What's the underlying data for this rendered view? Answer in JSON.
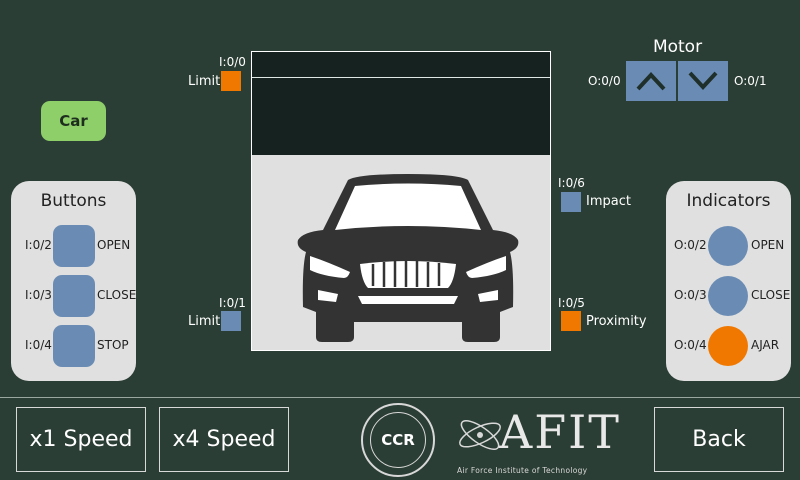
{
  "car_button": "Car",
  "garage": {
    "top_limit": {
      "addr": "I:0/0",
      "label": "Limit",
      "color": "#f07800"
    },
    "bottom_limit": {
      "addr": "I:0/1",
      "label": "Limit",
      "color": "#6a8cb4"
    },
    "impact": {
      "addr": "I:0/6",
      "label": "Impact",
      "color": "#6a8cb4"
    },
    "proximity": {
      "addr": "I:0/5",
      "label": "Proximity",
      "color": "#f07800"
    }
  },
  "motor": {
    "title": "Motor",
    "up_addr": "O:0/0",
    "down_addr": "O:0/1",
    "up_icon": "chevron-up-icon",
    "down_icon": "chevron-down-icon"
  },
  "buttons_panel": {
    "title": "Buttons",
    "items": [
      {
        "addr": "I:0/2",
        "label": "OPEN"
      },
      {
        "addr": "I:0/3",
        "label": "CLOSE"
      },
      {
        "addr": "I:0/4",
        "label": "STOP"
      }
    ]
  },
  "indicators_panel": {
    "title": "Indicators",
    "items": [
      {
        "addr": "O:0/2",
        "label": "OPEN",
        "color": "#6a8cb4"
      },
      {
        "addr": "O:0/3",
        "label": "CLOSE",
        "color": "#6a8cb4"
      },
      {
        "addr": "O:0/4",
        "label": "AJAR",
        "color": "#f07800"
      }
    ]
  },
  "footer": {
    "speed1": "x1 Speed",
    "speed4": "x4 Speed",
    "back": "Back",
    "ccr_logo_text": "CCR",
    "afit_logo_text": "AFIT",
    "afit_subtitle": "Air Force Institute of Technology"
  }
}
